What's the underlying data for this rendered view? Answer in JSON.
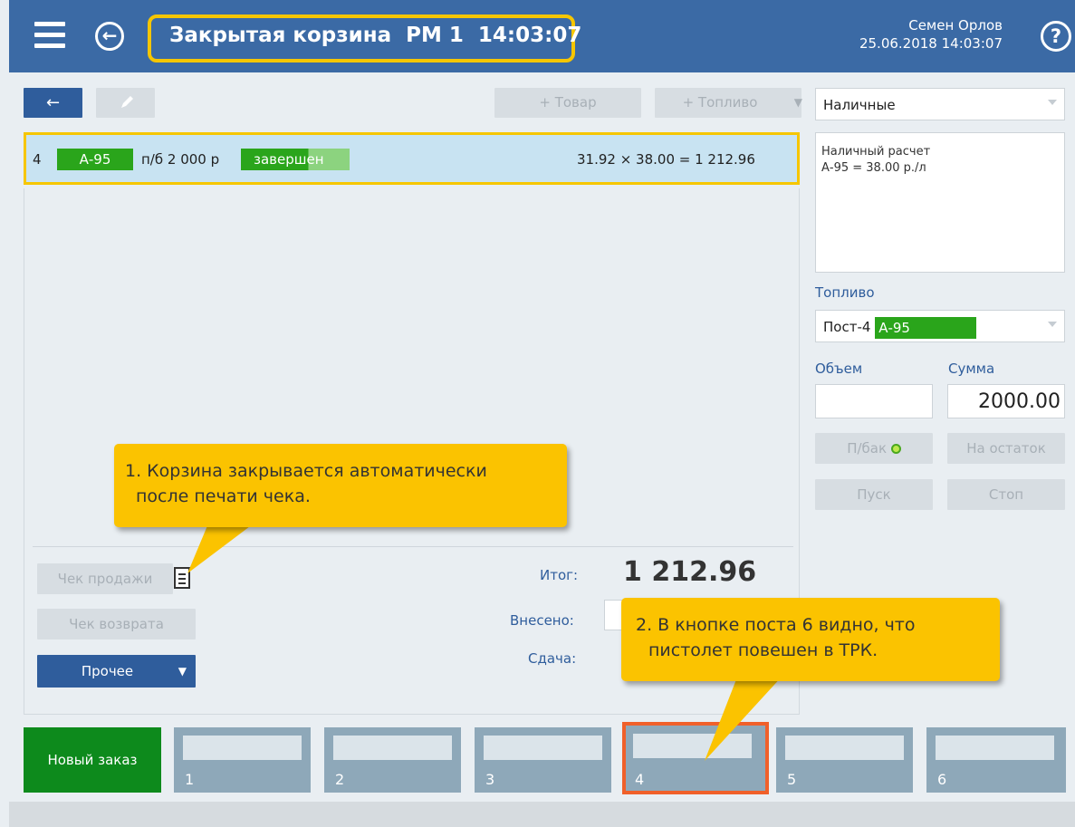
{
  "header": {
    "title": "Закрытая корзина  РМ 1  14:03:07",
    "user_name": "Семен Орлов",
    "datetime": "25.06.2018 14:03:07",
    "help_icon": "?",
    "back_icon": "arrow-left-circle"
  },
  "toolbar": {
    "back_label": "←",
    "edit_icon": "pencil-icon",
    "add_goods": "+ Товар",
    "add_fuel": "+ Топливо"
  },
  "basket": {
    "rows": [
      {
        "index": "4",
        "fuel": "А-95",
        "desc": "п/б 2 000 р",
        "status": "завершен",
        "calc": "31.92 × 38.00 = 1 212.96"
      }
    ]
  },
  "totals": {
    "total_label": "Итог:",
    "total_value": "1 212.96",
    "paid_label": "Внесено:",
    "change_label": "Сдача:"
  },
  "actions": {
    "sale_receipt": "Чек продажи",
    "return_receipt": "Чек возврата",
    "other": "Прочее"
  },
  "right_panel": {
    "payment_method": "Наличные",
    "info_line1": "Наличный расчет",
    "info_line2": "А-95 = 38.00 р./л",
    "fuel_section_label": "Топливо",
    "fuel_post": "Пост-4",
    "fuel_type": "А-95",
    "volume_label": "Объем",
    "sum_label": "Сумма",
    "sum_value": "2000.00",
    "fill_tank": "П/бак",
    "remainder": "На остаток",
    "start": "Пуск",
    "stop": "Стоп"
  },
  "callouts": {
    "c1_line1": "1. Корзина закрывается автоматически",
    "c1_line2": "после печати чека.",
    "c2_line1": "2. В кнопке поста 6 видно, что",
    "c2_line2": "пистолет повешен в ТРК."
  },
  "posts": {
    "new_order": "Новый заказ",
    "items": [
      "1",
      "2",
      "3",
      "4",
      "5",
      "6"
    ]
  },
  "colors": {
    "header": "#3b6aa5",
    "fuel_green": "#2aa51b",
    "highlight_yellow": "#f6c600",
    "callout": "#fbc300",
    "post_highlight": "#f0602a",
    "post_button": "#8ea8b9"
  }
}
